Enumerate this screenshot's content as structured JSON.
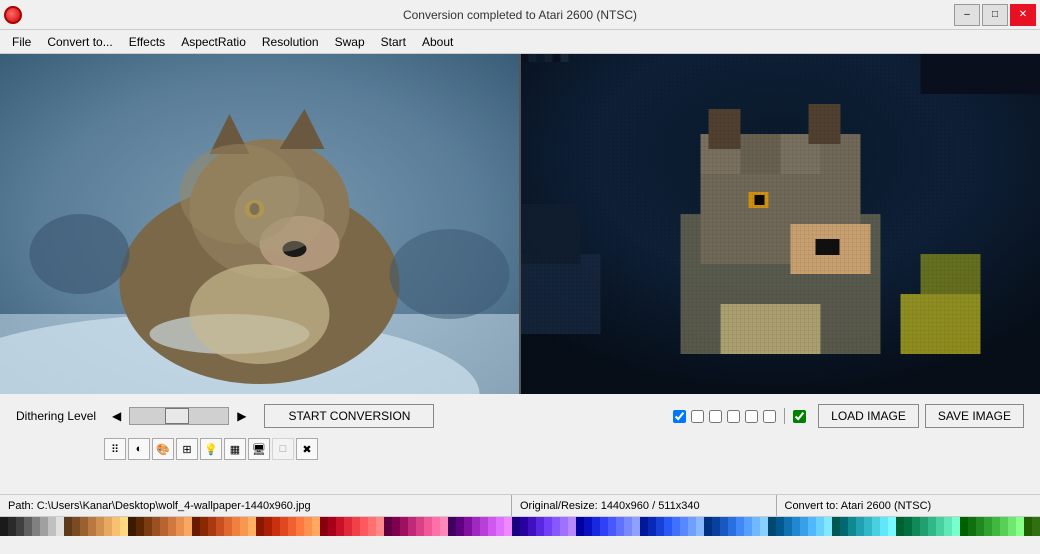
{
  "titlebar": {
    "title": "Conversion completed to Atari 2600 (NTSC)",
    "min_label": "–",
    "max_label": "□",
    "close_label": "✕"
  },
  "menu": {
    "items": [
      {
        "id": "file",
        "label": "File"
      },
      {
        "id": "convert-to",
        "label": "Convert to..."
      },
      {
        "id": "effects",
        "label": "Effects"
      },
      {
        "id": "aspect-ratio",
        "label": "AspectRatio"
      },
      {
        "id": "resolution",
        "label": "Resolution"
      },
      {
        "id": "swap",
        "label": "Swap"
      },
      {
        "id": "start",
        "label": "Start"
      },
      {
        "id": "about",
        "label": "About"
      }
    ]
  },
  "controls": {
    "dithering_label": "Dithering Level",
    "start_btn": "START CONVERSION",
    "load_btn": "LOAD IMAGE",
    "save_btn": "SAVE IMAGE"
  },
  "statusbar": {
    "path_label": "Path: C:\\Users\\Kanar\\Desktop\\wolf_4-wallpaper-1440x960.jpg",
    "resize_label": "Original/Resize:  1440x960 / 511x340",
    "convert_label": "Convert to:  Atari 2600 (NTSC)"
  },
  "palette": {
    "colors": [
      "#1a1a1a",
      "#2a2a2a",
      "#404040",
      "#606060",
      "#808080",
      "#a0a0a0",
      "#c0c0c0",
      "#e0e0e0",
      "#5c3a1a",
      "#7a4a20",
      "#9a6030",
      "#b87840",
      "#d09050",
      "#e8a860",
      "#f8c070",
      "#ffd880",
      "#3a1a00",
      "#5a2800",
      "#7a3c10",
      "#9a5020",
      "#b86430",
      "#d07840",
      "#e89050",
      "#f8a860",
      "#6a1a00",
      "#8a2800",
      "#aa3810",
      "#c85020",
      "#e06830",
      "#f08040",
      "#f89850",
      "#ffb060",
      "#8a1800",
      "#aa2000",
      "#ca3010",
      "#e04820",
      "#f06030",
      "#ff7840",
      "#ff9050",
      "#ffa860",
      "#880010",
      "#a80018",
      "#c81028",
      "#e02838",
      "#f04048",
      "#ff5860",
      "#ff7070",
      "#ff8888",
      "#600040",
      "#800050",
      "#a01060",
      "#c02878",
      "#d84088",
      "#f05898",
      "#ff70a8",
      "#ff88b8",
      "#400060",
      "#600080",
      "#8010a0",
      "#a028c0",
      "#b840d8",
      "#d058f0",
      "#e070ff",
      "#f088ff",
      "#180080",
      "#2800a0",
      "#4010c0",
      "#5828e0",
      "#7040f8",
      "#8858ff",
      "#a070ff",
      "#b888ff",
      "#0000a0",
      "#0810c0",
      "#1828e0",
      "#3040f8",
      "#4858ff",
      "#6070ff",
      "#7888ff",
      "#90a0ff",
      "#001898",
      "#0828b8",
      "#1840d8",
      "#2858f8",
      "#4070ff",
      "#5888ff",
      "#70a0ff",
      "#88b8ff",
      "#003080",
      "#0840a0",
      "#1858c0",
      "#2870e0",
      "#4088f8",
      "#58a0ff",
      "#70b8ff",
      "#88d0ff",
      "#004870",
      "#005890",
      "#1070b0",
      "#2088d0",
      "#38a0e8",
      "#50b8ff",
      "#68d0ff",
      "#80e8ff",
      "#005850",
      "#006870",
      "#108890",
      "#20a0b0",
      "#30b8c8",
      "#48d0e0",
      "#60e8f8",
      "#78f8ff",
      "#006030",
      "#007040",
      "#108858",
      "#20a070",
      "#30b888",
      "#48d0a0",
      "#60e8b8",
      "#78ffd0",
      "#006000",
      "#107010",
      "#208820",
      "#30a030",
      "#40b840",
      "#58d058",
      "#70e870",
      "#88ff88",
      "#206000",
      "#307010",
      "#408820",
      "#50a030",
      "#60b840",
      "#78d058",
      "#90e870",
      "#a8ff88",
      "#385000",
      "#486010",
      "#587820",
      "#689030",
      "#78a840",
      "#90c058",
      "#a8d870",
      "#c0f088",
      "#504000",
      "#605010",
      "#706820",
      "#808030",
      "#909840",
      "#a8b058",
      "#c0c870",
      "#d8e088",
      "#603000",
      "#704010",
      "#805820",
      "#907030",
      "#a08840",
      "#b8a058",
      "#d0b870",
      "#e8d088"
    ]
  },
  "checkboxes": [
    {
      "id": "cb1",
      "checked": true
    },
    {
      "id": "cb2",
      "checked": false
    },
    {
      "id": "cb3",
      "checked": false
    },
    {
      "id": "cb4",
      "checked": false
    },
    {
      "id": "cb5",
      "checked": false
    },
    {
      "id": "cb6",
      "checked": false
    },
    {
      "id": "cb7",
      "checked": true
    }
  ],
  "icon_buttons": [
    {
      "id": "icon-dots",
      "icon": "⠿",
      "disabled": false
    },
    {
      "id": "icon-circle-half",
      "icon": "◐",
      "disabled": false
    },
    {
      "id": "icon-palette",
      "icon": "🎨",
      "disabled": false
    },
    {
      "id": "icon-grid",
      "icon": "⊞",
      "disabled": false
    },
    {
      "id": "icon-lightbulb",
      "icon": "💡",
      "disabled": false
    },
    {
      "id": "icon-chip",
      "icon": "▦",
      "disabled": false
    },
    {
      "id": "icon-monitor",
      "icon": "🖥",
      "disabled": false
    },
    {
      "id": "icon-monitor2",
      "icon": "□",
      "disabled": true
    },
    {
      "id": "icon-x",
      "icon": "✖",
      "disabled": false
    }
  ]
}
